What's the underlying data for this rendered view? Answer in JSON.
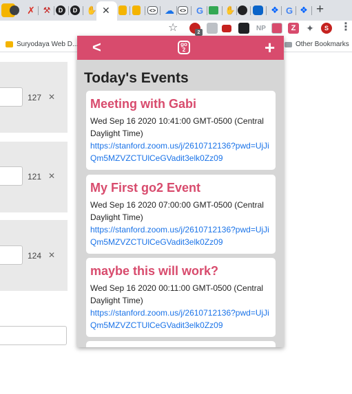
{
  "browser": {
    "tab_icons": [
      "pinwheel-icon",
      "chrome-icon",
      "red-x-icon",
      "tools-icon",
      "d-icon",
      "d-icon",
      "hand-icon",
      "hand-icon",
      "code-icon",
      "cloud-icon",
      "code-icon",
      "google-icon",
      "sheet-icon",
      "hand-icon",
      "github-icon",
      "outlook-icon",
      "dropbox-icon",
      "google-icon",
      "dropbox-icon"
    ],
    "close_glyph": "✕",
    "new_tab_glyph": "+",
    "extension_badge": "2",
    "np_label": "NP",
    "profile_initial": "S"
  },
  "bookmarks": {
    "left_item": "Suryodaya Web D...",
    "right_item": "Other Bookmarks"
  },
  "background_page": {
    "rows": [
      {
        "number": "127",
        "remove": "✕"
      },
      {
        "number": "121",
        "remove": "✕"
      },
      {
        "number": "124",
        "remove": "✕"
      }
    ]
  },
  "popup": {
    "back_glyph": "<",
    "add_glyph": "+",
    "logo_top": "go",
    "logo_bottom": "2",
    "title": "Today's Events",
    "events": [
      {
        "title": "Meeting with Gabi",
        "time": "Wed Sep 16 2020 10:41:00 GMT-0500 (Central Daylight Time)",
        "link": "https://stanford.zoom.us/j/2610712136?pwd=UjJiQm5MZVZCTUlCeGVadit3elk0Zz09"
      },
      {
        "title": "My First go2 Event",
        "time": "Wed Sep 16 2020 07:00:00 GMT-0500 (Central Daylight Time)",
        "link": "https://stanford.zoom.us/j/2610712136?pwd=UjJiQm5MZVZCTUlCeGVadit3elk0Zz09"
      },
      {
        "title": "maybe this will work?",
        "time": "Wed Sep 16 2020 00:11:00 GMT-0500 (Central Daylight Time)",
        "link": "https://stanford.zoom.us/j/2610712136?pwd=UjJiQm5MZVZCTUlCeGVadit3elk0Zz09"
      }
    ]
  },
  "colors": {
    "brand": "#d84b6d",
    "link": "#1a73e8",
    "panel": "#d6d6d6"
  }
}
